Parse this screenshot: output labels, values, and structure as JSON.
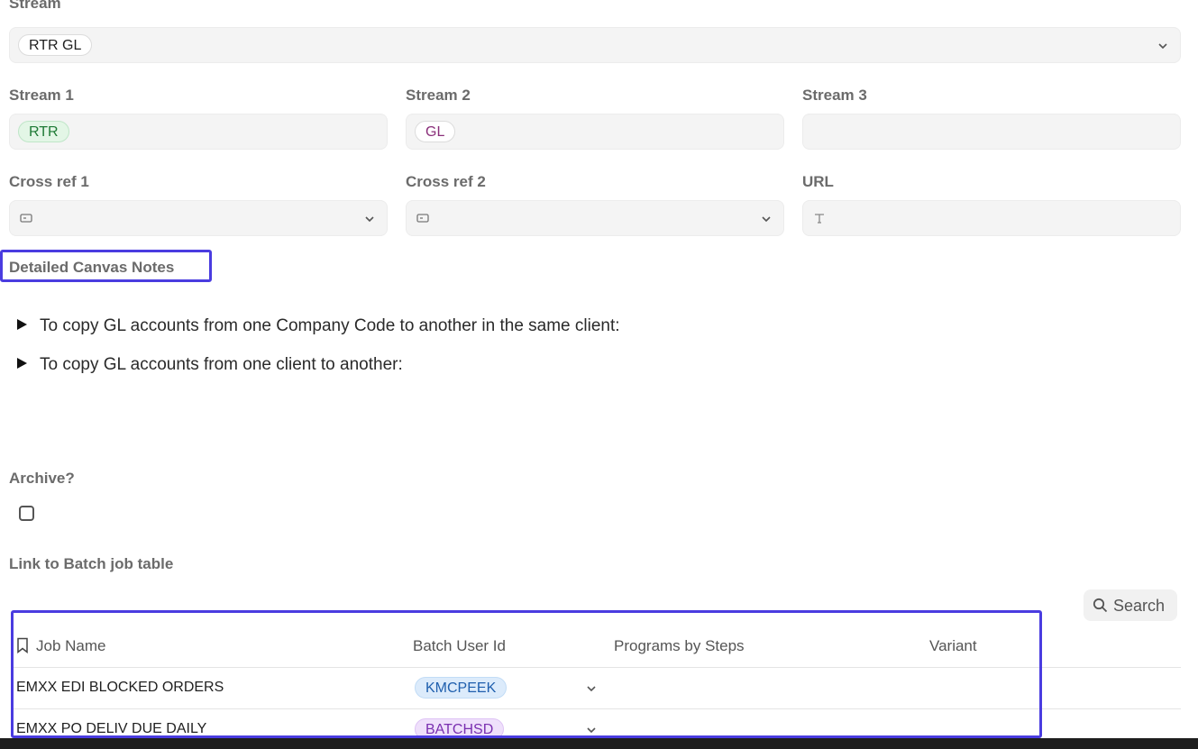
{
  "stream": {
    "label": "Stream",
    "value": "RTR GL"
  },
  "stream1": {
    "label": "Stream 1",
    "value": "RTR"
  },
  "stream2": {
    "label": "Stream 2",
    "value": "GL"
  },
  "stream3": {
    "label": "Stream 3",
    "value": ""
  },
  "crossref1": {
    "label": "Cross ref 1",
    "icon": "card-icon"
  },
  "crossref2": {
    "label": "Cross ref 2",
    "icon": "card-icon"
  },
  "url": {
    "label": "URL",
    "icon": "text-icon"
  },
  "notes": {
    "label": "Detailed Canvas Notes",
    "items": [
      "To copy GL accounts from one Company Code to another in the same client:",
      "To copy GL accounts from one client to another:"
    ]
  },
  "archive": {
    "label": "Archive?",
    "checked": false
  },
  "batch": {
    "label": "Link to Batch job table",
    "search_label": "Search",
    "columns": [
      "Job Name",
      "Batch User Id",
      "Programs by Steps",
      "Variant"
    ],
    "rows": [
      {
        "job_name": "EMXX EDI BLOCKED ORDERS",
        "user_id": "KMCPEEK"
      },
      {
        "job_name": "EMXX PO DELIV DUE DAILY",
        "user_id": "BATCHSD"
      }
    ]
  },
  "colors": {
    "highlight": "#4a3ce0",
    "chip_green_bg": "#e3f6e6",
    "chip_green_text": "#1e7a35",
    "chip_blue_bg": "#dcebfb",
    "chip_blue_text": "#1f5fae",
    "chip_purple_bg": "#efe0fb",
    "chip_purple_text": "#7a2fb0"
  }
}
